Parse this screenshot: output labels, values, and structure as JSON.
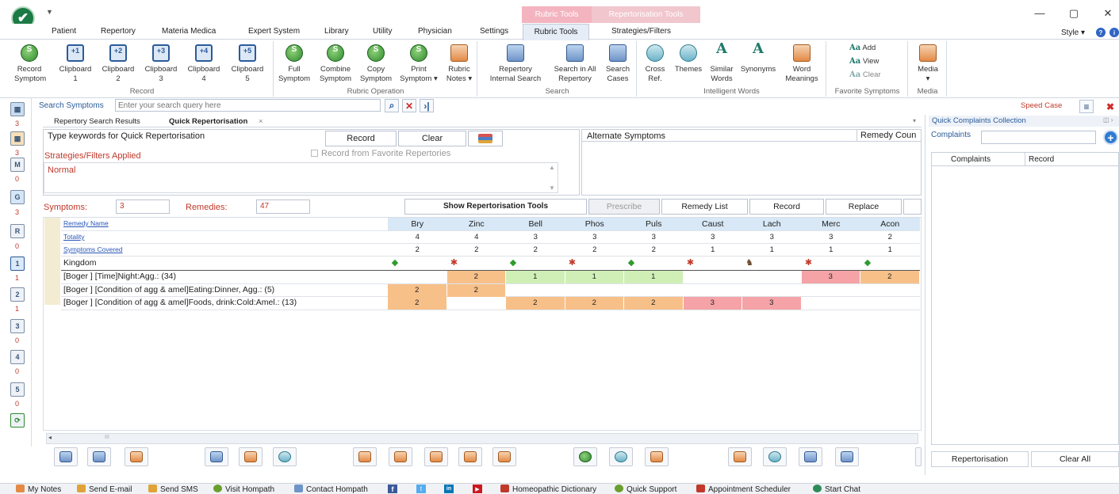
{
  "window": {
    "quick_access": "▼",
    "ctx_tab_1": "Rubric Tools",
    "ctx_tab_2": "Repertorisation Tools",
    "min": "—",
    "restore": "▢",
    "close": "✕"
  },
  "menu": {
    "items": [
      "Patient",
      "Repertory",
      "Materia Medica",
      "Expert System",
      "Library",
      "Utility",
      "Physician",
      "Settings",
      "Rubric Tools",
      "Strategies/Filters"
    ],
    "style_label": "Style"
  },
  "ribbon": {
    "groups": {
      "record": "Record",
      "rubric_operation": "Rubric Operation",
      "search": "Search",
      "intelligent_words": "Intelligent Words",
      "favorite_symptoms": "Favorite Symptoms",
      "media": "Media"
    },
    "record_buttons": [
      [
        "Record",
        "Symptom"
      ],
      [
        "Clipboard",
        "1"
      ],
      [
        "Clipboard",
        "2"
      ],
      [
        "Clipboard",
        "3"
      ],
      [
        "Clipboard",
        "4"
      ],
      [
        "Clipboard",
        "5"
      ]
    ],
    "clip_icons": [
      "+1",
      "+2",
      "+3",
      "+4",
      "+5"
    ],
    "rubric_buttons": [
      [
        "Full",
        "Symptom"
      ],
      [
        "Combine",
        "Symptom"
      ],
      [
        "Copy",
        "Symptom"
      ],
      [
        "Print",
        "Symptom ▾"
      ],
      [
        "Rubric",
        "Notes ▾"
      ]
    ],
    "search_buttons": [
      [
        "Repertory",
        "Internal Search"
      ],
      [
        "Search in All",
        "Repertory"
      ],
      [
        "Search",
        "Cases"
      ]
    ],
    "intelligent_buttons": [
      [
        "Cross",
        "Ref."
      ],
      [
        "Themes",
        ""
      ],
      [
        "Similar",
        "Words"
      ],
      [
        "Synonyms",
        ""
      ],
      [
        "Word",
        "Meanings"
      ]
    ],
    "fav_items": [
      "Add",
      "View",
      "Clear"
    ],
    "media_button": "Media"
  },
  "search": {
    "label": "Search Symptoms",
    "placeholder": "Enter your search query here",
    "speed_case": "Speed Case"
  },
  "sidebar": {
    "numbers": [
      "3",
      "3",
      "0",
      "3",
      "0",
      "1",
      "1",
      "0",
      "0",
      "0",
      "0"
    ],
    "letters": [
      "M",
      "G",
      "R",
      "1",
      "2",
      "3",
      "4",
      "5"
    ]
  },
  "tabs": {
    "results": "Repertory Search Results",
    "quick": "Quick Repertorisation",
    "close": "×"
  },
  "quick": {
    "keyword_input": "Type keywords for Quick Repertorisation",
    "record_btn": "Record",
    "clear_btn": "Clear",
    "strategies_label": "Strategies/Filters Applied",
    "fav_checkbox": "Record from Favorite Repertories",
    "strategy_value": "Normal",
    "alternate": "Alternate Symptoms",
    "remedy_count": "Remedy Coun",
    "symptoms_label": "Symptoms:",
    "symptoms_value": "3",
    "remedies_label": "Remedies:",
    "remedies_value": "47"
  },
  "toolbar2": [
    "Show Repertorisation Tools",
    "Prescribe",
    "Remedy List",
    "Record",
    "Replace"
  ],
  "grid": {
    "row_labels": {
      "remedy_name": "Remedy Name",
      "totality": "Totality",
      "covered": "Symptoms Covered",
      "kingdom": "Kingdom"
    },
    "remedies": [
      "Bry",
      "Zinc",
      "Bell",
      "Phos",
      "Puls",
      "Caust",
      "Lach",
      "Merc",
      "Acon"
    ],
    "totality": [
      "4",
      "4",
      "3",
      "3",
      "3",
      "3",
      "3",
      "3",
      "2"
    ],
    "covered": [
      "2",
      "2",
      "2",
      "2",
      "2",
      "1",
      "1",
      "1",
      "1"
    ],
    "kingdom": [
      "plant",
      "mineral",
      "plant",
      "mineral",
      "plant",
      "mineral",
      "animal",
      "mineral",
      "plant"
    ],
    "rubrics": [
      {
        "label": "[Boger ] [Time]Night:Agg.: (34)",
        "cells": [
          "",
          "2",
          "1",
          "1",
          "1",
          "",
          "",
          "3",
          "2"
        ]
      },
      {
        "label": "[Boger ] [Condition of agg & amel]Eating:Dinner, Agg.: (5)",
        "cells": [
          "2",
          "2",
          "",
          "",
          "",
          "",
          "",
          "",
          ""
        ]
      },
      {
        "label": "[Boger ] [Condition of agg & amel]Foods, drink:Cold:Amel.: (13)",
        "cells": [
          "2",
          "",
          "2",
          "2",
          "2",
          "3",
          "3",
          "",
          ""
        ]
      }
    ],
    "grade_colors": {
      "1": "#cfefb6",
      "2": "#f7c089",
      "3": "#f5a3a7"
    }
  },
  "right_panel": {
    "title": "Quick Complaints Collection",
    "complaints_label": "Complaints",
    "col_complaints": "Complaints",
    "col_record": "Record",
    "repertorisation_btn": "Repertorisation",
    "clear_all_btn": "Clear All"
  },
  "status": [
    "My Notes",
    "Send E-mail",
    "Send SMS",
    "Visit Hompath",
    "Contact Hompath",
    "Homeopathic Dictionary",
    "Quick Support",
    "Appointment Scheduler",
    "Start Chat"
  ]
}
